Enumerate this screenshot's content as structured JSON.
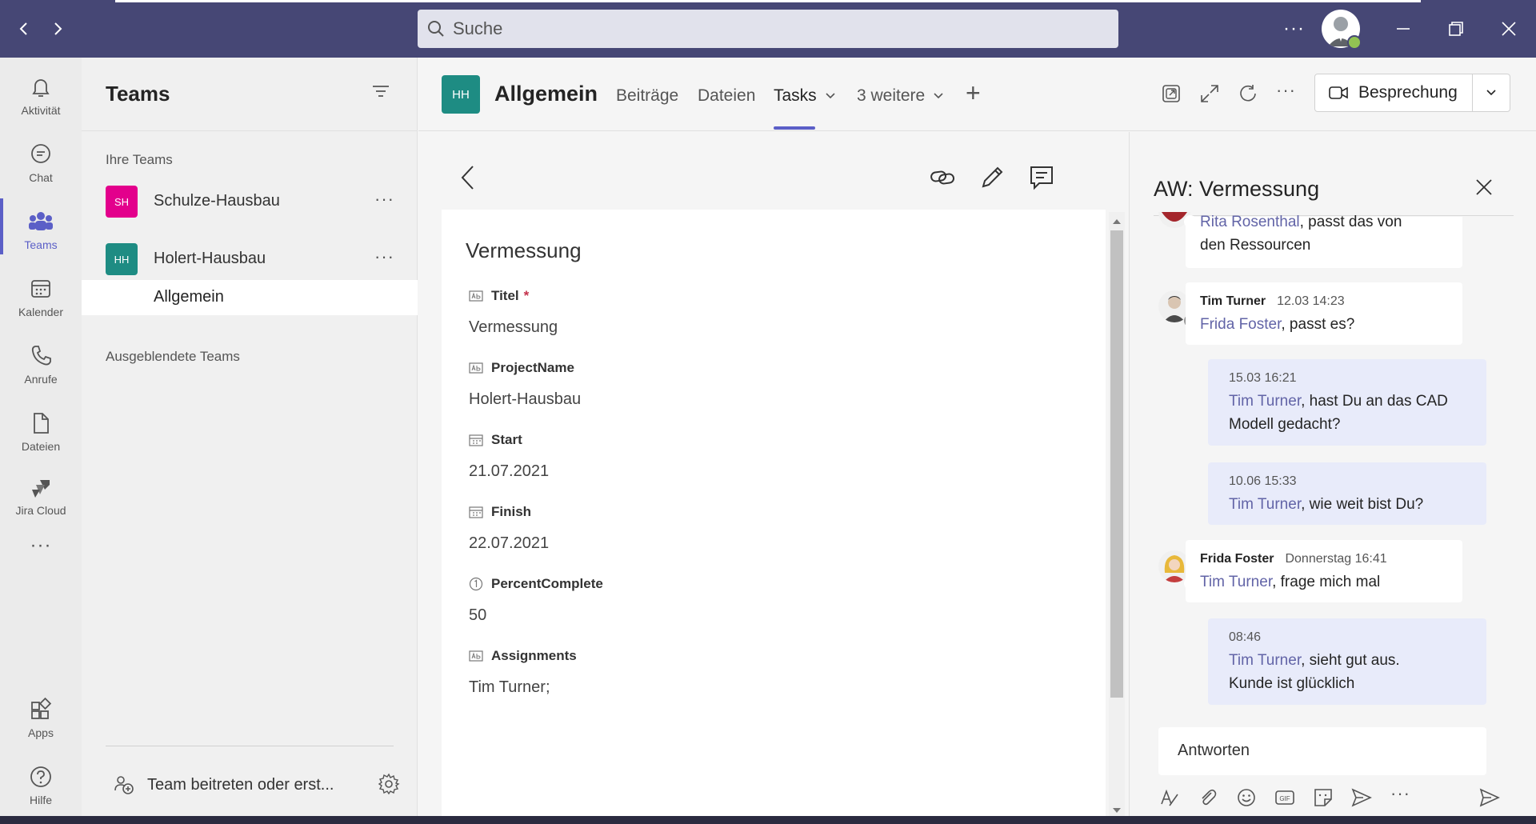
{
  "titlebar": {
    "search_placeholder": "Suche",
    "more": "···",
    "brand_color": "#464775",
    "icons": [
      "back-arrow-icon",
      "forward-arrow-icon",
      "search-icon",
      "minimize-icon",
      "restore-icon",
      "close-icon"
    ]
  },
  "rail": {
    "items": [
      {
        "label": "Aktivität",
        "icon": "bell-icon"
      },
      {
        "label": "Chat",
        "icon": "chat-icon"
      },
      {
        "label": "Teams",
        "icon": "teams-icon",
        "active": true
      },
      {
        "label": "Kalender",
        "icon": "calendar-icon"
      },
      {
        "label": "Anrufe",
        "icon": "phone-icon"
      },
      {
        "label": "Dateien",
        "icon": "file-icon"
      },
      {
        "label": "Jira Cloud",
        "icon": "jira-icon"
      },
      {
        "label": "Apps",
        "icon": "apps-icon"
      },
      {
        "label": "Hilfe",
        "icon": "help-icon"
      }
    ],
    "more": "···"
  },
  "leftpanel": {
    "title": "Teams",
    "your_teams_label": "Ihre Teams",
    "teams": [
      {
        "initials": "SH",
        "name": "Schulze-Hausbau",
        "color": "#e3008c",
        "more": "···"
      },
      {
        "initials": "HH",
        "name": "Holert-Hausbau",
        "color": "#1e8c83",
        "more": "···"
      }
    ],
    "channel": "Allgemein",
    "hidden_teams_label": "Ausgeblendete Teams",
    "join_label": "Team beitreten oder erst..."
  },
  "header": {
    "channel_initials": "HH",
    "channel_title": "Allgemein",
    "tabs": [
      {
        "label": "Beiträge"
      },
      {
        "label": "Dateien"
      },
      {
        "label": "Tasks",
        "active": true
      },
      {
        "label": "3 weitere"
      }
    ],
    "add_tab": "+",
    "more": "···",
    "meeting_label": "Besprechung",
    "accent": "#5b5fc7"
  },
  "task": {
    "title": "Vermessung",
    "fields": [
      {
        "label": "Titel",
        "required_mark": "*",
        "value": "Vermessung",
        "icon": "text-field-icon"
      },
      {
        "label": "ProjectName",
        "required_mark": "",
        "value": "Holert-Hausbau",
        "icon": "text-field-icon"
      },
      {
        "label": "Start",
        "required_mark": "",
        "value": "21.07.2021",
        "icon": "calendar-field-icon"
      },
      {
        "label": "Finish",
        "required_mark": "",
        "value": "22.07.2021",
        "icon": "calendar-field-icon"
      },
      {
        "label": "PercentComplete",
        "required_mark": "",
        "value": "50",
        "icon": "number-field-icon"
      },
      {
        "label": "Assignments",
        "required_mark": "",
        "value": "Tim Turner;",
        "icon": "text-field-icon"
      }
    ]
  },
  "conversation": {
    "title": "AW: Vermessung",
    "messages": [
      {
        "mention": "Rita Rosenthal",
        "line1_rest": ", passt das von",
        "line2": "den Ressourcen"
      },
      {
        "author": "Tim Turner",
        "time": "12.03 14:23",
        "mention": "Frida Foster",
        "text": ", passt es?"
      },
      {
        "time": "15.03 16:21",
        "mention": "Tim Turner",
        "line1_rest": ", hast Du an das CAD",
        "line2": "Modell gedacht?"
      },
      {
        "time": "10.06 15:33",
        "mention": "Tim Turner",
        "text": ", wie weit bist Du?"
      },
      {
        "author": "Frida Foster",
        "time": "Donnerstag 16:41",
        "mention": "Tim Turner",
        "text": ", frage mich mal"
      },
      {
        "time": "08:46",
        "mention": "Tim Turner",
        "line1_rest": ", sieht gut aus.",
        "line2": "Kunde ist glücklich"
      }
    ],
    "reply_placeholder": "Antworten",
    "mention_color": "#6264a7",
    "self_bubble_color": "#e8ebfa"
  }
}
